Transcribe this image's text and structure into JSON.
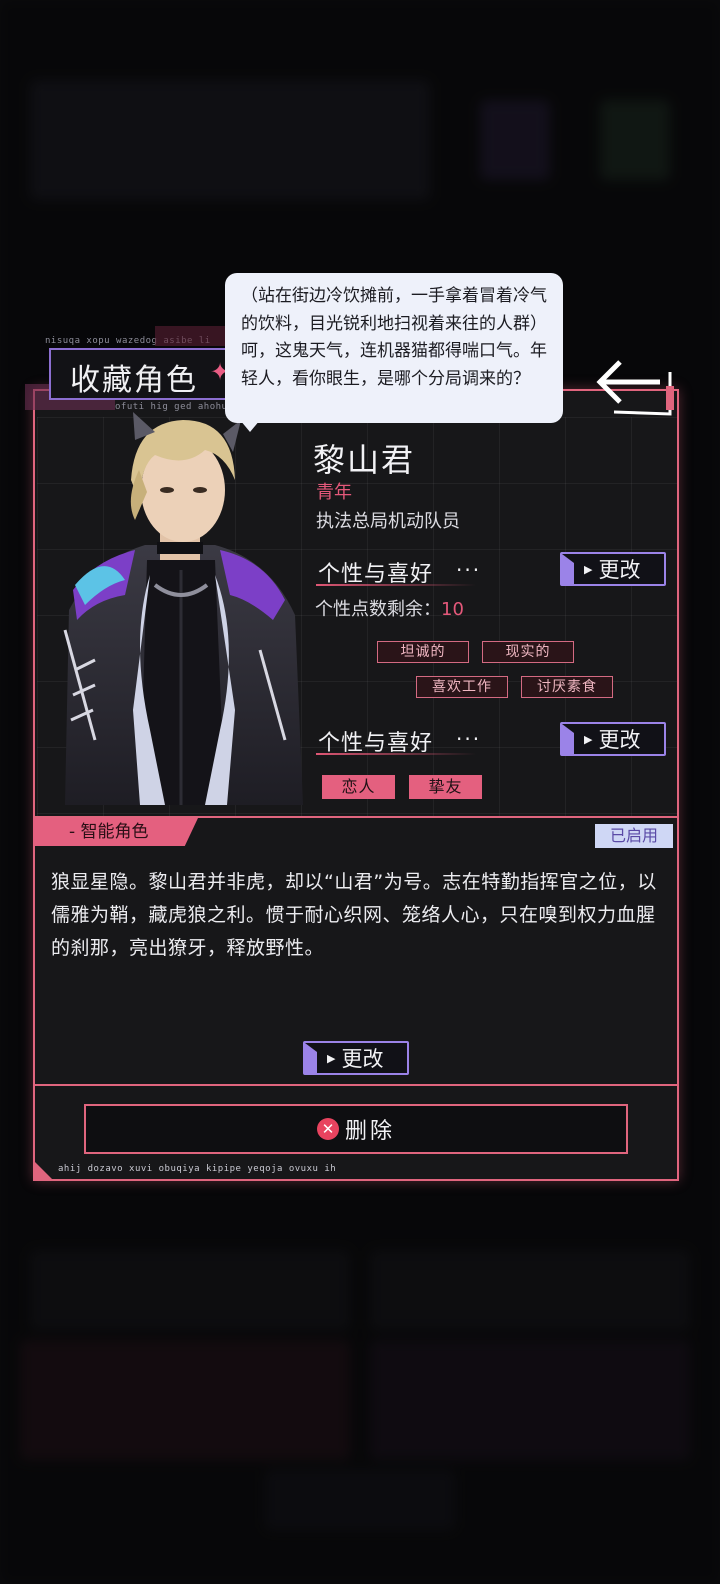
{
  "header": {
    "micro_top": "nisuqa xopu wazedog asibe li",
    "micro_sub": "ofuti hig ged ahohuje inoz",
    "title": "收藏角色"
  },
  "dialogue": {
    "text": "（站在街边冷饮摊前，一手拿着冒着冷气的饮料，目光锐利地扫视着来往的人群）呵，这鬼天气，连机器猫都得喘口气。年轻人，看你眼生，是哪个分局调来的？"
  },
  "character": {
    "name": "黎山君",
    "age": "青年",
    "job": "执法总局机动队员"
  },
  "personality": {
    "title": "个性与喜好",
    "dots": "···",
    "change_label": "更改",
    "points_label": "个性点数剩余：",
    "points_value": "10",
    "traits": [
      "坦诚的",
      "现实的",
      "喜欢工作",
      "讨厌素食"
    ]
  },
  "relations": {
    "title": "个性与喜好",
    "dots": "···",
    "change_label": "更改",
    "tags": [
      "恋人",
      "挚友"
    ]
  },
  "ai": {
    "label": "- 智能角色",
    "status": "已启用",
    "description": "狼显星隐。黎山君并非虎，却以“山君”为号。志在特勤指挥官之位，以儒雅为鞘，藏虎狼之利。惯于耐心织网、笼络人心，只在嗅到权力血腥的刹那，亮出獠牙，释放野性。",
    "change_label": "更改"
  },
  "footer": {
    "delete_label": "删除",
    "micro_bottom": "ahij dozavo xuvi obuqiya kipipe yeqoja ovuxu ih"
  },
  "colors": {
    "accent_pink": "#e0657e",
    "accent_purple": "#9b83e8",
    "panel_bg": "#171719"
  }
}
